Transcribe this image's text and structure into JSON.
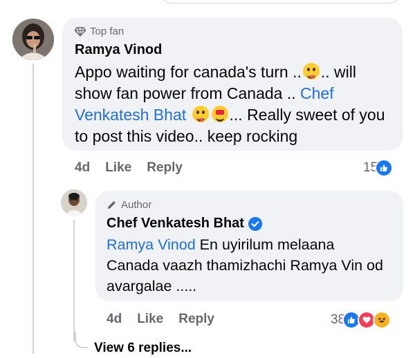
{
  "comment": {
    "badge": "Top fan",
    "author": "Ramya Vinod",
    "text_part1": "Appo waiting for canada's turn ..",
    "text_part2": ".. will show fan power from Canada ..",
    "mention": "Chef Venkatesh Bhat",
    "text_part3": "... Really sweet of you to post this video.. keep rocking",
    "time": "4d",
    "like_label": "Like",
    "reply_label": "Reply",
    "reaction_count": "15",
    "emojis": [
      "winking-tongue-emoji",
      "heart-eyes-emoji"
    ]
  },
  "reply": {
    "badge": "Author",
    "author": "Chef Venkatesh Bhat",
    "mention": "Ramya Vinod",
    "text": "En uyirilum melaana Canada vaazh thamizhachi Ramya Vin od avargalae .....",
    "time": "4d",
    "like_label": "Like",
    "reply_label": "Reply",
    "reaction_count": "38",
    "reactions": [
      "like",
      "love",
      "haha"
    ]
  },
  "view_replies": "View 6 replies...",
  "colors": {
    "bubble": "#f0f2f5",
    "mention": "#216fdb",
    "secondary_text": "#65676b",
    "like": "#1877f2",
    "love": "#f33e58",
    "haha": "#f7b125",
    "verified": "#1877f2"
  }
}
